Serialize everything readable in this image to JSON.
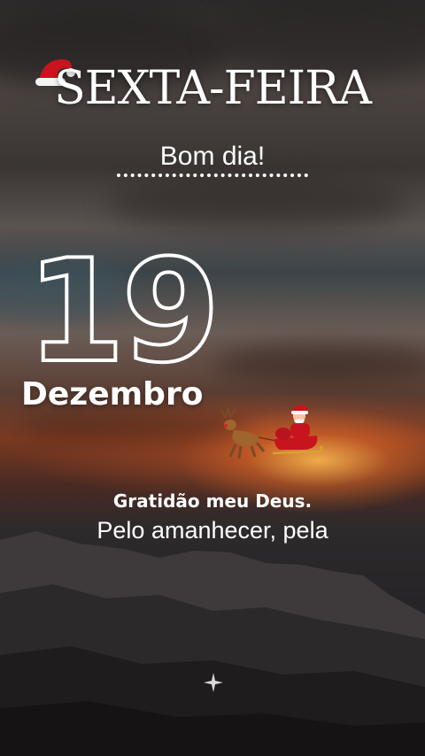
{
  "header": {
    "weekday": "SEXTA-FEIRA",
    "greeting": "Bom dia!"
  },
  "date": {
    "day": "19",
    "month": "Dezembro"
  },
  "message": {
    "headline": "Gratidão meu Deus.",
    "body": "Pelo amanhecer, pela"
  },
  "icons": {
    "hat": "santa-hat-icon",
    "sleigh": "santa-sleigh-icon",
    "sparkle": "sparkle-icon"
  },
  "colors": {
    "text": "#ffffff",
    "hat_red": "#c8141e",
    "sunset": "#ff9a3c"
  }
}
